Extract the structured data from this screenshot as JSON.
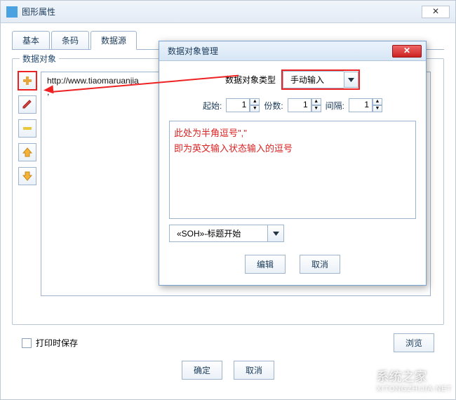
{
  "main": {
    "title": "图形属性",
    "closeGlyph": "✕",
    "tabs": [
      {
        "label": "基本"
      },
      {
        "label": "条码"
      },
      {
        "label": "数据源"
      }
    ],
    "activeTab": 2,
    "group": {
      "legend": "数据对象",
      "items": [
        "http://www.tiaomaruanjia",
        ","
      ]
    },
    "tools": {
      "add": "add-icon",
      "edit": "pencil-icon",
      "delete": "minus-icon",
      "up": "arrow-up-icon",
      "down": "arrow-down-icon"
    },
    "saveOnPrint": "打印时保存",
    "browse": "浏览",
    "ok": "确定",
    "cancel": "取消"
  },
  "modal": {
    "title": "数据对象管理",
    "closeGlyph": "✕",
    "typeLabel": "数据对象类型",
    "typeValue": "手动输入",
    "startLabel": "起始:",
    "startValue": "1",
    "copiesLabel": "份数:",
    "copiesValue": "1",
    "intervalLabel": "间隔:",
    "intervalValue": "1",
    "hintLine1": "此处为半角逗号\",\"",
    "hintLine2": "即为英文输入状态输入的逗号",
    "sohValue": "«SOH»-标题开始",
    "editBtn": "编辑",
    "cancelBtn": "取消"
  },
  "watermark": {
    "name": "系统之家",
    "url": "XITONGZHIJIA.NET"
  }
}
